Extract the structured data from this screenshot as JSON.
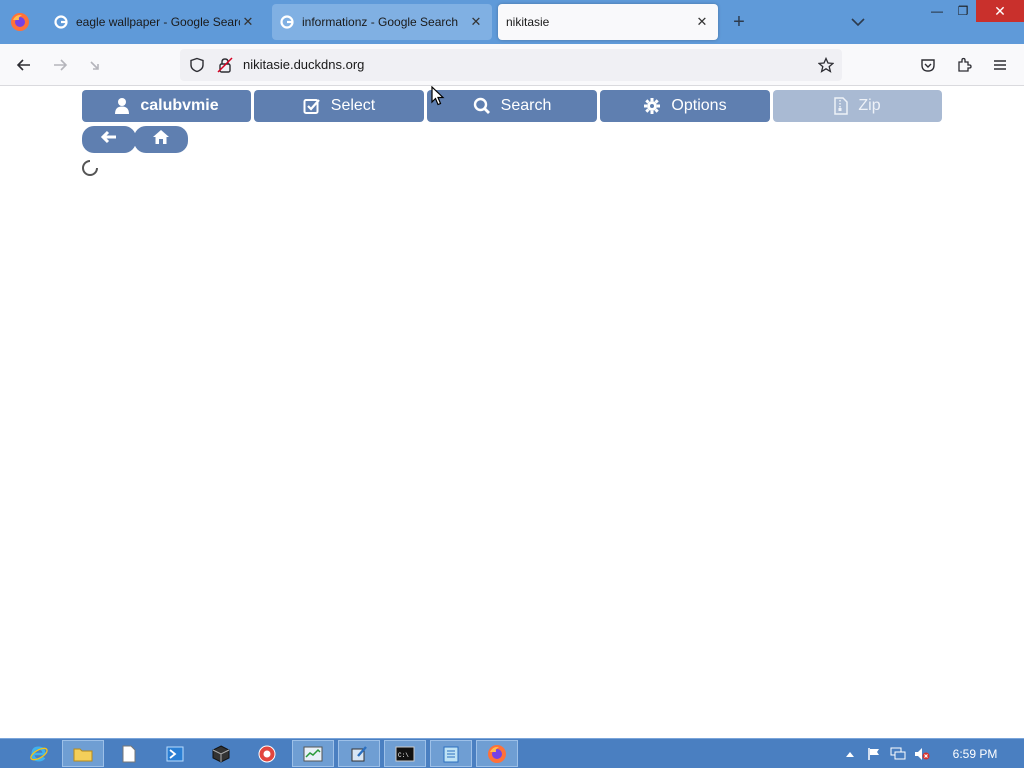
{
  "browser": {
    "tabs": [
      {
        "title": "eagle wallpaper - Google Search",
        "close": "✕"
      },
      {
        "title": "informationz - Google Search",
        "close": "✕"
      },
      {
        "title": "nikitasie",
        "close": "✕"
      }
    ],
    "new_tab": "+",
    "window_controls": {
      "minimize": "—",
      "restore": "❐",
      "close": "✕"
    },
    "url": "nikitasie.duckdns.org"
  },
  "app": {
    "menu": [
      {
        "label": "calubvmie",
        "icon": "user-icon"
      },
      {
        "label": "Select",
        "icon": "checkbox-icon"
      },
      {
        "label": "Search",
        "icon": "search-icon"
      },
      {
        "label": "Options",
        "icon": "gear-icon"
      },
      {
        "label": "Zip",
        "icon": "zip-file-icon",
        "disabled": true
      }
    ],
    "nav": {
      "back_icon": "arrow-left-icon",
      "home_icon": "home-icon"
    },
    "loading": true
  },
  "taskbar": {
    "clock": "6:59 PM"
  },
  "colors": {
    "tabbar": "#5f9ad9",
    "button": "#5f7fb0",
    "button_disabled": "#a9bad3",
    "taskbar": "#4a7fc1"
  }
}
